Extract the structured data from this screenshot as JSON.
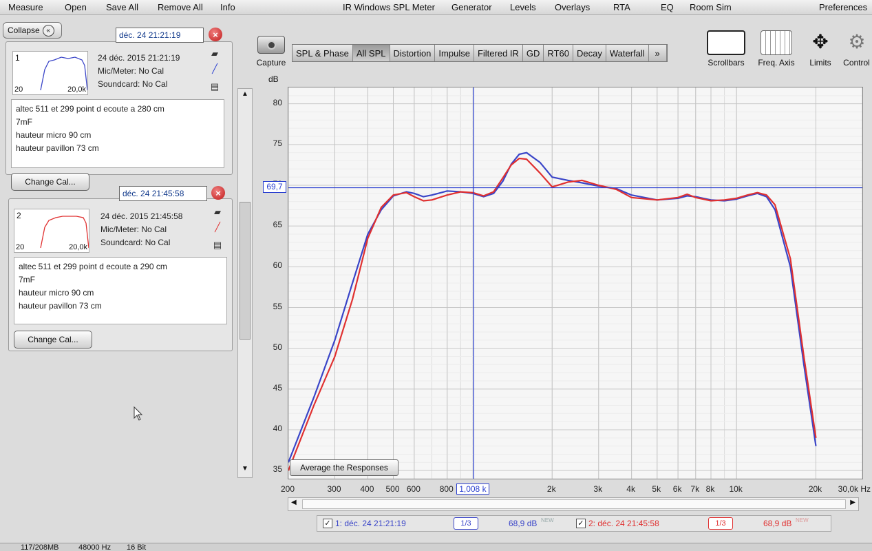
{
  "menu": [
    "Measure",
    "Open",
    "Save All",
    "Remove All",
    "Info",
    "IR Windows",
    "SPL Meter",
    "Generator",
    "Levels",
    "Overlays",
    "RTA",
    "EQ",
    "Room Sim",
    "Preferences"
  ],
  "left_panel": {
    "collapse_label": "Collapse",
    "collapse_glyph": "«",
    "change_cal_label": "Change Cal...",
    "measurements": [
      {
        "number": "1",
        "tab_label": "déc. 24 21:21:19",
        "date": "24 déc. 2015 21:21:19",
        "mic": "Mic/Meter: No Cal",
        "soundcard": "Soundcard: No Cal",
        "thumb_lo": "20",
        "thumb_hi": "20,0k",
        "color": "#3a45c8",
        "notes": [
          "altec 511 et 299 point d ecoute a 280 cm",
          "7mF",
          "hauteur micro 90 cm",
          "hauteur pavillon 73 cm"
        ]
      },
      {
        "number": "2",
        "tab_label": "déc. 24 21:45:58",
        "date": "24 déc. 2015 21:45:58",
        "mic": "Mic/Meter: No Cal",
        "soundcard": "Soundcard: No Cal",
        "thumb_lo": "20",
        "thumb_hi": "20,0k",
        "color": "#e03030",
        "notes": [
          "altec 511 et 299 point d ecoute a 290 cm",
          "7mF",
          "hauteur micro 90 cm",
          "hauteur pavillon 73 cm"
        ]
      }
    ]
  },
  "toolbar": {
    "capture_label": "Capture",
    "tabs": [
      "SPL & Phase",
      "All SPL",
      "Distortion",
      "Impulse",
      "Filtered IR",
      "GD",
      "RT60",
      "Decay",
      "Waterfall",
      "»"
    ],
    "active_tab": "All SPL",
    "tools": [
      "Scrollbars",
      "Freq. Axis",
      "Limits",
      "Control"
    ]
  },
  "graph": {
    "y_unit": "dB",
    "cursor_y_label": "69,7",
    "cursor_x_label": "1,008 k",
    "average_button": "Average the Responses"
  },
  "chart_data": {
    "type": "line",
    "x_scale": "log",
    "xlim": [
      200,
      30000
    ],
    "ylim": [
      34,
      82
    ],
    "y_ticks": [
      35,
      40,
      45,
      50,
      55,
      60,
      65,
      70,
      75,
      80
    ],
    "y_tick_labels": [
      "35",
      "40",
      "45",
      "50",
      "55",
      "60",
      "65",
      "70",
      "75",
      "80"
    ],
    "x_ticks": [
      200,
      300,
      400,
      500,
      600,
      800,
      2000,
      3000,
      4000,
      5000,
      6000,
      7000,
      8000,
      10000,
      20000,
      30000
    ],
    "x_tick_labels": [
      "200",
      "300",
      "400",
      "500",
      "600",
      "800",
      "2k",
      "3k",
      "4k",
      "5k",
      "6k",
      "7k",
      "8k",
      "10k",
      "20k",
      "30,0k Hz"
    ],
    "cursor_freq": 1008,
    "cursor_db": 69.7,
    "series": [
      {
        "name": "1: déc. 24 21:21:19",
        "color": "#3a45c8",
        "x": [
          200,
          250,
          300,
          350,
          400,
          450,
          500,
          560,
          600,
          650,
          700,
          800,
          900,
          1000,
          1100,
          1200,
          1300,
          1400,
          1500,
          1600,
          1800,
          2000,
          2300,
          2600,
          3000,
          3500,
          4000,
          5000,
          6000,
          6500,
          7000,
          8000,
          9000,
          10000,
          11000,
          12000,
          13000,
          14000,
          16000,
          18000,
          20000
        ],
        "y": [
          36,
          44,
          51,
          58,
          64,
          67,
          68.7,
          69.2,
          69,
          68.6,
          68.8,
          69.3,
          69.2,
          69,
          68.6,
          69,
          70.5,
          72.6,
          73.8,
          74,
          72.8,
          71,
          70.6,
          70.3,
          69.9,
          69.6,
          68.8,
          68.2,
          68.4,
          68.7,
          68.6,
          68.2,
          68.1,
          68.3,
          68.7,
          69,
          68.6,
          67,
          60,
          48,
          38
        ]
      },
      {
        "name": "2: déc. 24 21:45:58",
        "color": "#e03030",
        "x": [
          200,
          250,
          300,
          350,
          400,
          450,
          500,
          560,
          600,
          650,
          700,
          800,
          900,
          1000,
          1100,
          1200,
          1300,
          1400,
          1500,
          1600,
          1800,
          2000,
          2300,
          2600,
          3000,
          3500,
          4000,
          5000,
          6000,
          6500,
          7000,
          8000,
          9000,
          10000,
          11000,
          12000,
          13000,
          14000,
          16000,
          18000,
          20000
        ],
        "y": [
          35,
          43,
          49,
          56,
          63.5,
          67.3,
          68.8,
          69.1,
          68.6,
          68.1,
          68.2,
          68.8,
          69.2,
          69.1,
          68.7,
          69.2,
          70.9,
          72.5,
          73.3,
          73.2,
          71.5,
          69.8,
          70.4,
          70.6,
          70,
          69.5,
          68.5,
          68.2,
          68.5,
          68.9,
          68.5,
          68.1,
          68.2,
          68.4,
          68.8,
          69.1,
          68.8,
          67.6,
          61,
          49,
          39
        ]
      }
    ]
  },
  "legend": [
    {
      "checked": "✓",
      "label": "1: déc. 24 21:21:19",
      "smoothing": "1/3",
      "level": "68,9 dB",
      "badge": "NEW",
      "color": "#3a45c8"
    },
    {
      "checked": "✓",
      "label": "2: déc. 24 21:45:58",
      "smoothing": "1/3",
      "level": "68,9 dB",
      "badge": "NEW",
      "color": "#e03030"
    }
  ],
  "status": [
    "117/208MB",
    "48000 Hz",
    "16 Bit"
  ]
}
